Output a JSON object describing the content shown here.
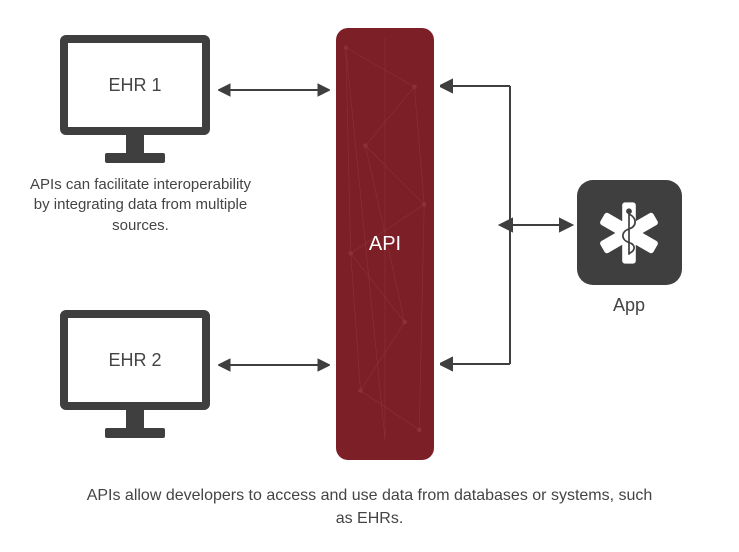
{
  "ehr1_label": "EHR 1",
  "ehr2_label": "EHR 2",
  "api_label": "API",
  "app_label": "App",
  "interop_text": "APIs can facilitate interoperability by integrating data from multiple sources.",
  "bottom_text": "APIs allow developers to access and use data from databases or systems, such as EHRs.",
  "colors": {
    "api_bg": "#7d1f27",
    "icon_dark": "#3f3f3f"
  }
}
